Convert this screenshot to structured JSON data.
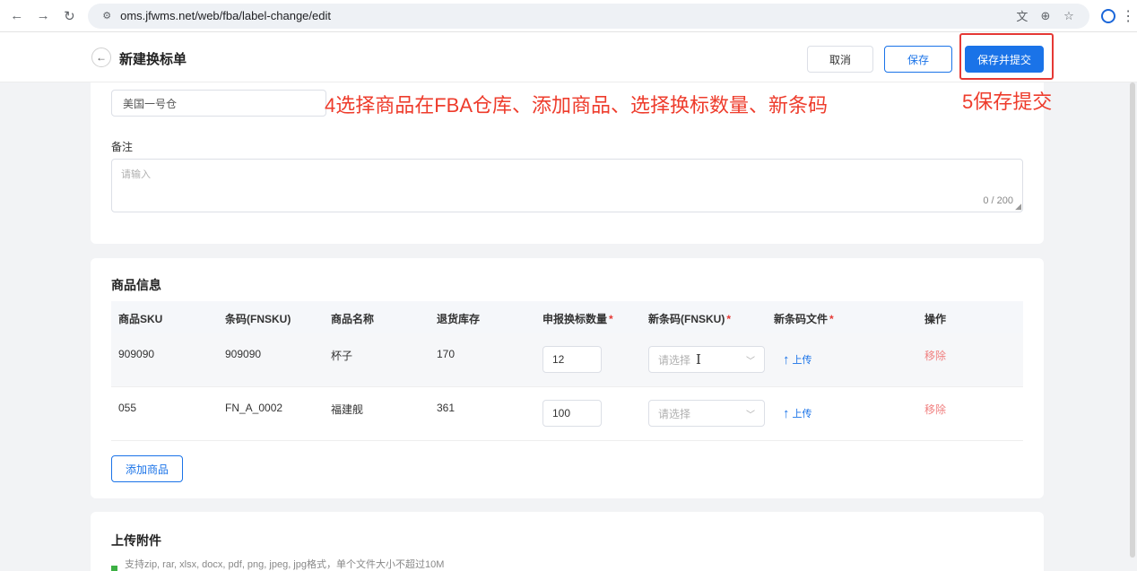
{
  "browser": {
    "url": "oms.jfwms.net/web/fba/label-change/edit"
  },
  "header": {
    "title": "新建换标单",
    "cancel_label": "取消",
    "save_label": "保存",
    "submit_label": "保存并提交"
  },
  "form": {
    "warehouse_value": "美国一号仓",
    "remark_label": "备注",
    "remark_placeholder": "请输入",
    "remark_count": "0 / 200"
  },
  "annotations": {
    "step4": "4选择商品在FBA仓库、添加商品、选择换标数量、新条码",
    "step5": "5保存提交"
  },
  "goods": {
    "title": "商品信息",
    "columns": {
      "sku": "商品SKU",
      "fnsku": "条码(FNSKU)",
      "name": "商品名称",
      "stock": "退货库存",
      "qty": "申报换标数量",
      "new_fnsku": "新条码(FNSKU)",
      "new_file": "新条码文件",
      "action": "操作"
    },
    "required_mark": "*",
    "select_placeholder": "请选择",
    "upload_label": "上传",
    "remove_label": "移除",
    "rows": [
      {
        "sku": "909090",
        "fnsku": "909090",
        "name": "杯子",
        "stock": "170",
        "qty": "12"
      },
      {
        "sku": "055",
        "fnsku": "FN_A_0002",
        "name": "福建舰",
        "stock": "361",
        "qty": "100"
      }
    ],
    "add_label": "添加商品"
  },
  "upload": {
    "title": "上传附件",
    "tip": "支持zip, rar, xlsx, docx, pdf, png, jpeg, jpg格式，单个文件大小不超过10M"
  },
  "colors": {
    "primary": "#1a73e8",
    "annotation": "#ee3c2c",
    "danger": "#f08080"
  }
}
